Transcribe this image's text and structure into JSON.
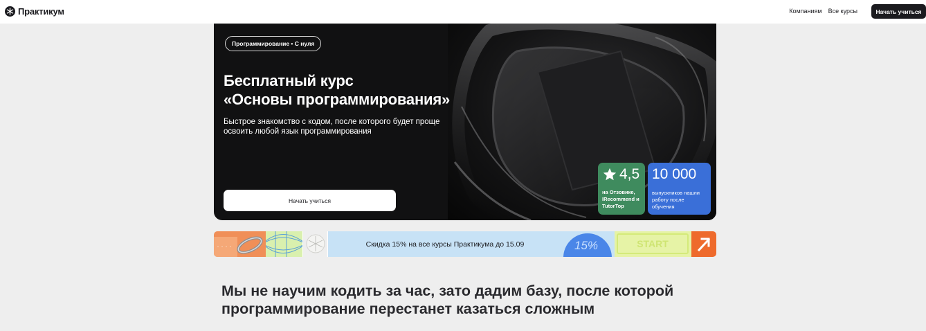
{
  "header": {
    "logo_text": "Практикум",
    "nav": [
      "Компаниям",
      "Все курсы"
    ],
    "cta": "Начать учиться"
  },
  "hero": {
    "tag": "Программирование • С нуля",
    "title": "Бесплатный курс\n«Основы программирования»",
    "subtitle": "Быстрое знакомство с кодом, после которого будет проще освоить любой язык программирования",
    "cta": "Начать учиться",
    "stats": {
      "rating_value": "4,5",
      "rating_caption": "на Отзовике, IRecommend и TutorTop",
      "graduates_value": "10 000",
      "graduates_caption": "выпускников нашли работу после обучения"
    }
  },
  "promo": {
    "text": "Скидка 15% на все курсы Практикума до 15.09",
    "percent_label": "15%",
    "start_label": "START"
  },
  "manifesto": "Мы не научим кодить за час, зато дадим базу, после которой программирование перестанет казаться сложным",
  "colors": {
    "hero_bg": "#111112",
    "rating_badge": "#3f8b5e",
    "graduates_badge": "#3a6fd8",
    "promo_blue": "#c7e2f6",
    "promo_orange": "#ee6a2c"
  }
}
